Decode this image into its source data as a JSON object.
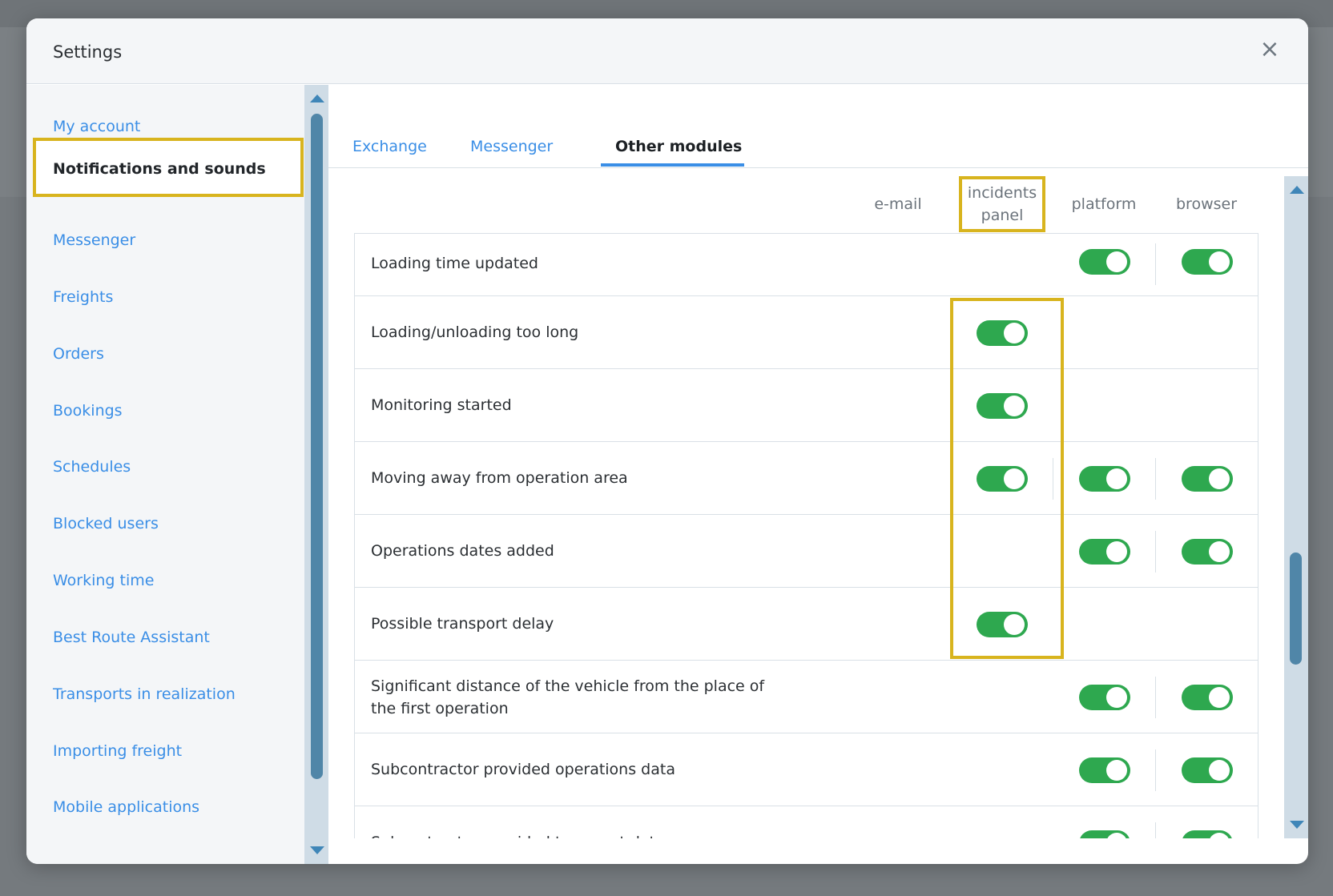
{
  "modal": {
    "title": "Settings",
    "close_icon": "×"
  },
  "sidebar": {
    "items": [
      {
        "label": "My account"
      },
      {
        "label": "Notifications and sounds",
        "active": true
      },
      {
        "label": "Messenger"
      },
      {
        "label": "Freights"
      },
      {
        "label": "Orders"
      },
      {
        "label": "Bookings"
      },
      {
        "label": "Schedules"
      },
      {
        "label": "Blocked users"
      },
      {
        "label": "Working time"
      },
      {
        "label": "Best Route Assistant"
      },
      {
        "label": "Transports in realization"
      },
      {
        "label": "Importing freight"
      },
      {
        "label": "Mobile applications"
      }
    ]
  },
  "tabs": [
    {
      "label": "Exchange"
    },
    {
      "label": "Messenger"
    },
    {
      "label": "Other modules",
      "active": true
    }
  ],
  "columns": {
    "email": "e-mail",
    "incidents_line1": "incidents",
    "incidents_line2": "panel",
    "platform": "platform",
    "browser": "browser"
  },
  "rows": [
    {
      "label": "Loading time updated",
      "email": false,
      "incidents": false,
      "platform": true,
      "browser": true
    },
    {
      "label": "Loading/unloading too long",
      "email": false,
      "incidents": true,
      "platform": false,
      "browser": false
    },
    {
      "label": "Monitoring started",
      "email": false,
      "incidents": true,
      "platform": false,
      "browser": false
    },
    {
      "label": "Moving away from operation area",
      "email": false,
      "incidents": true,
      "platform": true,
      "browser": true
    },
    {
      "label": "Operations dates added",
      "email": false,
      "incidents": false,
      "platform": true,
      "browser": true
    },
    {
      "label": "Possible transport delay",
      "email": false,
      "incidents": true,
      "platform": false,
      "browser": false
    },
    {
      "label": "Significant distance of the vehicle from the place of the first operation",
      "email": false,
      "incidents": false,
      "platform": true,
      "browser": true
    },
    {
      "label": "Subcontractor provided operations data",
      "email": false,
      "incidents": false,
      "platform": true,
      "browser": true
    },
    {
      "label": "Subcontractor provided transport data",
      "email": false,
      "incidents": false,
      "platform": true,
      "browser": true
    }
  ],
  "colors": {
    "accent": "#3a8ee6",
    "toggle_on": "#2ea84f",
    "highlight": "#d8b41e"
  }
}
